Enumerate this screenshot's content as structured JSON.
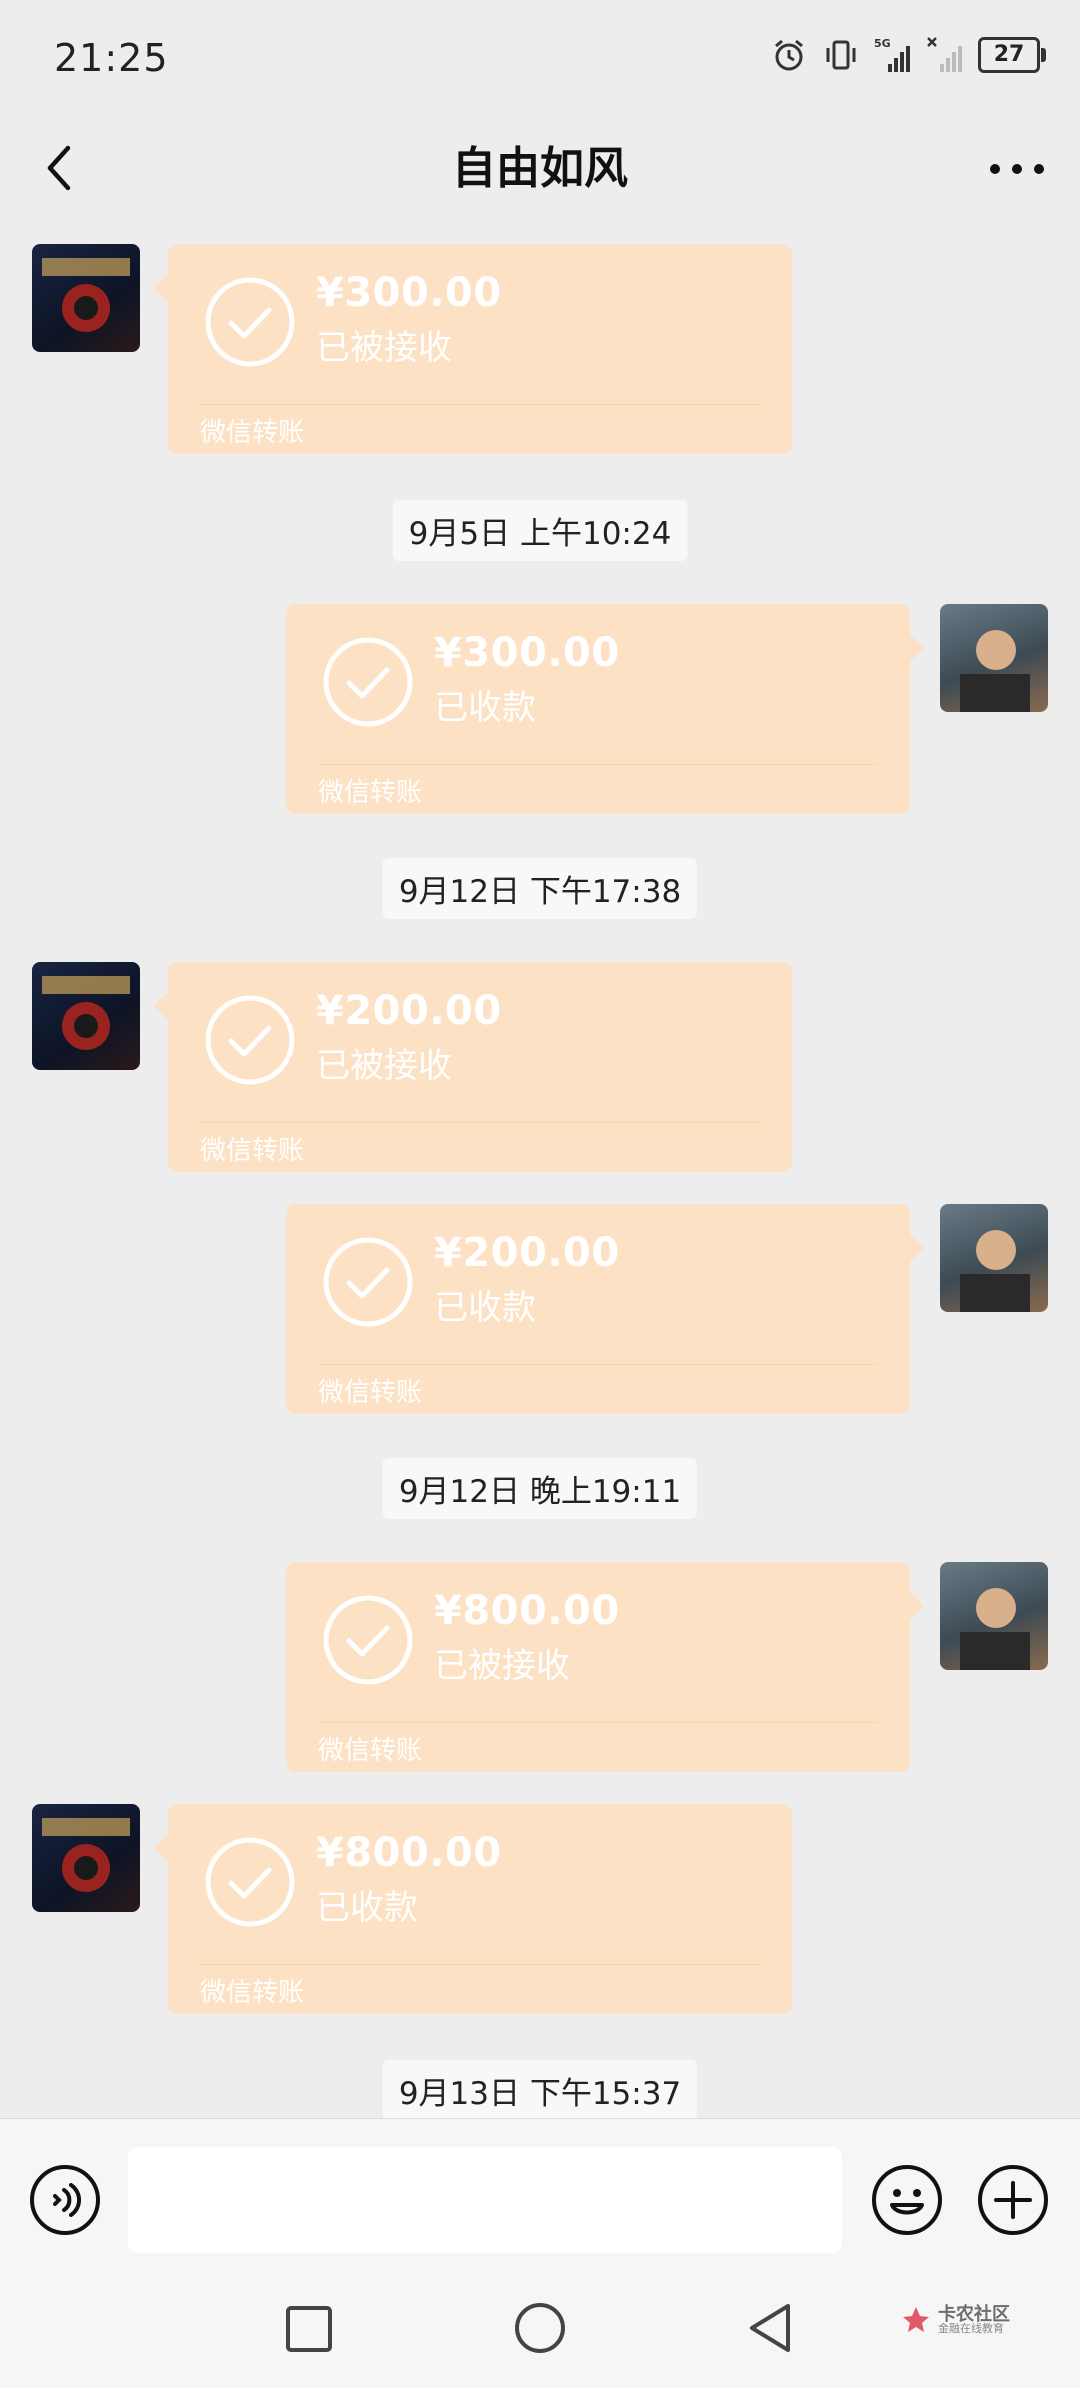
{
  "status_bar": {
    "time": "21:25",
    "network": "5G",
    "battery": "27"
  },
  "header": {
    "title": "自由如风"
  },
  "messages": [
    {
      "kind": "transfer",
      "side": "left",
      "amount": "¥300.00",
      "status": "已被接收",
      "caption": "微信转账"
    },
    {
      "kind": "time",
      "text": "9月5日 上午10:24"
    },
    {
      "kind": "transfer",
      "side": "right",
      "amount": "¥300.00",
      "status": "已收款",
      "caption": "微信转账"
    },
    {
      "kind": "time",
      "text": "9月12日 下午17:38"
    },
    {
      "kind": "transfer",
      "side": "left",
      "amount": "¥200.00",
      "status": "已被接收",
      "caption": "微信转账"
    },
    {
      "kind": "transfer",
      "side": "right",
      "amount": "¥200.00",
      "status": "已收款",
      "caption": "微信转账"
    },
    {
      "kind": "time",
      "text": "9月12日 晚上19:11"
    },
    {
      "kind": "transfer",
      "side": "right",
      "amount": "¥800.00",
      "status": "已被接收",
      "caption": "微信转账"
    },
    {
      "kind": "transfer",
      "side": "left",
      "amount": "¥800.00",
      "status": "已收款",
      "caption": "微信转账"
    },
    {
      "kind": "time",
      "text": "9月13日 下午15:37"
    }
  ],
  "input": {
    "value": ""
  },
  "watermark": {
    "title": "卡农社区",
    "subtitle": "金融在线教育"
  },
  "colors": {
    "bubble": "#fce1c4",
    "background": "#ededed",
    "input_bar": "#f6f6f6"
  }
}
